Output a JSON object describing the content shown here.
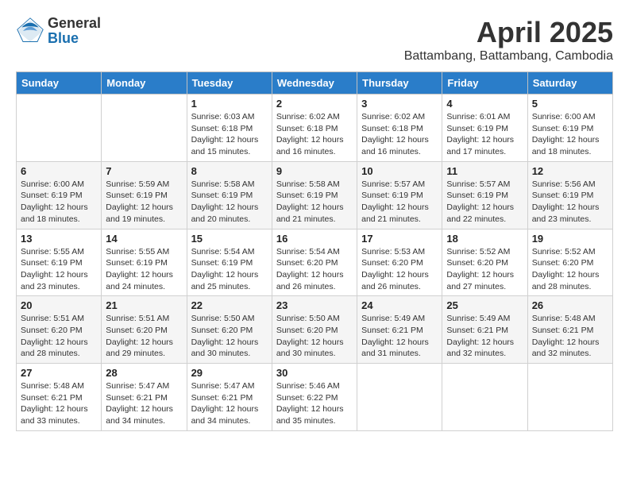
{
  "header": {
    "logo": {
      "general": "General",
      "blue": "Blue"
    },
    "title": "April 2025",
    "subtitle": "Battambang, Battambang, Cambodia"
  },
  "calendar": {
    "days_of_week": [
      "Sunday",
      "Monday",
      "Tuesday",
      "Wednesday",
      "Thursday",
      "Friday",
      "Saturday"
    ],
    "weeks": [
      [
        {
          "day": "",
          "info": ""
        },
        {
          "day": "",
          "info": ""
        },
        {
          "day": "1",
          "info": "Sunrise: 6:03 AM\nSunset: 6:18 PM\nDaylight: 12 hours and 15 minutes."
        },
        {
          "day": "2",
          "info": "Sunrise: 6:02 AM\nSunset: 6:18 PM\nDaylight: 12 hours and 16 minutes."
        },
        {
          "day": "3",
          "info": "Sunrise: 6:02 AM\nSunset: 6:18 PM\nDaylight: 12 hours and 16 minutes."
        },
        {
          "day": "4",
          "info": "Sunrise: 6:01 AM\nSunset: 6:19 PM\nDaylight: 12 hours and 17 minutes."
        },
        {
          "day": "5",
          "info": "Sunrise: 6:00 AM\nSunset: 6:19 PM\nDaylight: 12 hours and 18 minutes."
        }
      ],
      [
        {
          "day": "6",
          "info": "Sunrise: 6:00 AM\nSunset: 6:19 PM\nDaylight: 12 hours and 18 minutes."
        },
        {
          "day": "7",
          "info": "Sunrise: 5:59 AM\nSunset: 6:19 PM\nDaylight: 12 hours and 19 minutes."
        },
        {
          "day": "8",
          "info": "Sunrise: 5:58 AM\nSunset: 6:19 PM\nDaylight: 12 hours and 20 minutes."
        },
        {
          "day": "9",
          "info": "Sunrise: 5:58 AM\nSunset: 6:19 PM\nDaylight: 12 hours and 21 minutes."
        },
        {
          "day": "10",
          "info": "Sunrise: 5:57 AM\nSunset: 6:19 PM\nDaylight: 12 hours and 21 minutes."
        },
        {
          "day": "11",
          "info": "Sunrise: 5:57 AM\nSunset: 6:19 PM\nDaylight: 12 hours and 22 minutes."
        },
        {
          "day": "12",
          "info": "Sunrise: 5:56 AM\nSunset: 6:19 PM\nDaylight: 12 hours and 23 minutes."
        }
      ],
      [
        {
          "day": "13",
          "info": "Sunrise: 5:55 AM\nSunset: 6:19 PM\nDaylight: 12 hours and 23 minutes."
        },
        {
          "day": "14",
          "info": "Sunrise: 5:55 AM\nSunset: 6:19 PM\nDaylight: 12 hours and 24 minutes."
        },
        {
          "day": "15",
          "info": "Sunrise: 5:54 AM\nSunset: 6:19 PM\nDaylight: 12 hours and 25 minutes."
        },
        {
          "day": "16",
          "info": "Sunrise: 5:54 AM\nSunset: 6:20 PM\nDaylight: 12 hours and 26 minutes."
        },
        {
          "day": "17",
          "info": "Sunrise: 5:53 AM\nSunset: 6:20 PM\nDaylight: 12 hours and 26 minutes."
        },
        {
          "day": "18",
          "info": "Sunrise: 5:52 AM\nSunset: 6:20 PM\nDaylight: 12 hours and 27 minutes."
        },
        {
          "day": "19",
          "info": "Sunrise: 5:52 AM\nSunset: 6:20 PM\nDaylight: 12 hours and 28 minutes."
        }
      ],
      [
        {
          "day": "20",
          "info": "Sunrise: 5:51 AM\nSunset: 6:20 PM\nDaylight: 12 hours and 28 minutes."
        },
        {
          "day": "21",
          "info": "Sunrise: 5:51 AM\nSunset: 6:20 PM\nDaylight: 12 hours and 29 minutes."
        },
        {
          "day": "22",
          "info": "Sunrise: 5:50 AM\nSunset: 6:20 PM\nDaylight: 12 hours and 30 minutes."
        },
        {
          "day": "23",
          "info": "Sunrise: 5:50 AM\nSunset: 6:20 PM\nDaylight: 12 hours and 30 minutes."
        },
        {
          "day": "24",
          "info": "Sunrise: 5:49 AM\nSunset: 6:21 PM\nDaylight: 12 hours and 31 minutes."
        },
        {
          "day": "25",
          "info": "Sunrise: 5:49 AM\nSunset: 6:21 PM\nDaylight: 12 hours and 32 minutes."
        },
        {
          "day": "26",
          "info": "Sunrise: 5:48 AM\nSunset: 6:21 PM\nDaylight: 12 hours and 32 minutes."
        }
      ],
      [
        {
          "day": "27",
          "info": "Sunrise: 5:48 AM\nSunset: 6:21 PM\nDaylight: 12 hours and 33 minutes."
        },
        {
          "day": "28",
          "info": "Sunrise: 5:47 AM\nSunset: 6:21 PM\nDaylight: 12 hours and 34 minutes."
        },
        {
          "day": "29",
          "info": "Sunrise: 5:47 AM\nSunset: 6:21 PM\nDaylight: 12 hours and 34 minutes."
        },
        {
          "day": "30",
          "info": "Sunrise: 5:46 AM\nSunset: 6:22 PM\nDaylight: 12 hours and 35 minutes."
        },
        {
          "day": "",
          "info": ""
        },
        {
          "day": "",
          "info": ""
        },
        {
          "day": "",
          "info": ""
        }
      ]
    ]
  }
}
